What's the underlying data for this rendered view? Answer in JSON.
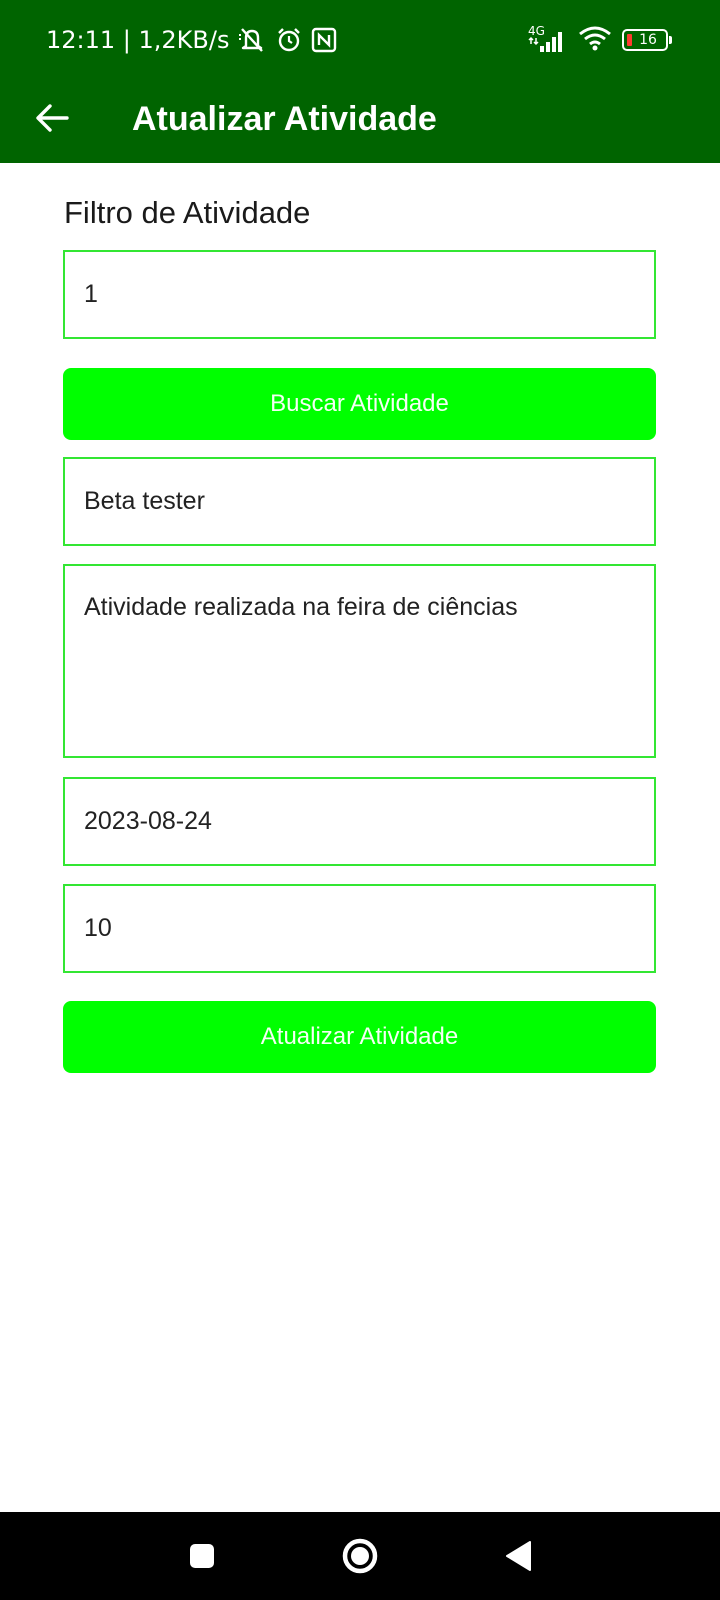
{
  "status_bar": {
    "time_speed": "12:11 | 1,2KB/s",
    "network_type": "4G",
    "battery_level": "16",
    "icons": [
      "bell-off-icon",
      "alarm-icon",
      "nfc-icon",
      "signal-icon",
      "wifi-icon",
      "battery-icon"
    ]
  },
  "app_bar": {
    "title": "Atualizar Atividade",
    "back_icon": "arrow-left-icon"
  },
  "form": {
    "section_label": "Filtro de Atividade",
    "filter_value": "1",
    "search_button": "Buscar Atividade",
    "name_value": "Beta tester",
    "description_value": "Atividade realizada na feira de ciências",
    "date_value": "2023-08-24",
    "number_value": "10",
    "update_button": "Atualizar Atividade"
  },
  "navigation": {
    "recents_icon": "square-icon",
    "home_icon": "circle-home-icon",
    "back_icon": "triangle-back-icon"
  },
  "colors": {
    "app_bar": "#006400",
    "button": "#00ff00",
    "field_border": "#33e633",
    "nav_bar": "#000000",
    "battery_low": "#ff3b30"
  }
}
